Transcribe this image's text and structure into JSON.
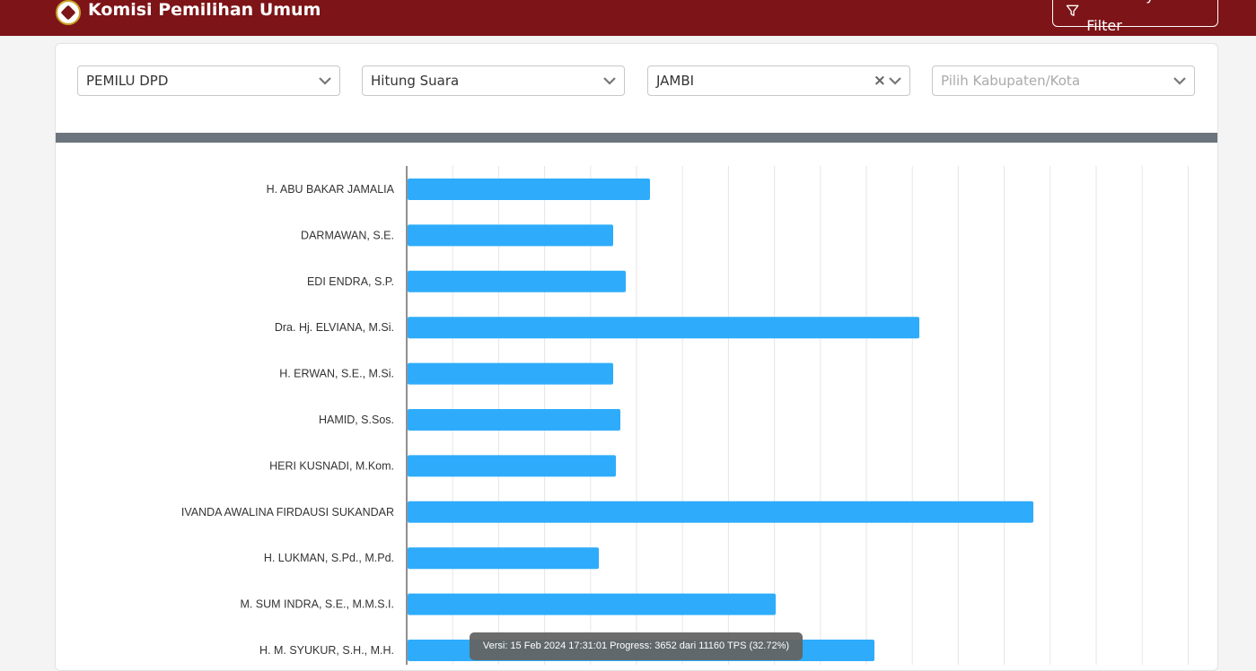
{
  "header": {
    "brand": "Komisi Pemilihan Umum",
    "filter_button": "Sembunyikan Filter"
  },
  "filters": {
    "election": "PEMILU DPD",
    "mode": "Hitung Suara",
    "province": "JAMBI",
    "regency_placeholder": "Pilih Kabupaten/Kota"
  },
  "colors": {
    "header_bg": "#7d1417",
    "bar": "#2eacfb",
    "divider": "#6c757d"
  },
  "tooltip": "Versi: 15 Feb 2024 17:31:01 Progress: 3652 dari 11160 TPS (32.72%)",
  "chart_data": {
    "type": "bar",
    "orientation": "horizontal",
    "grid": true,
    "categories": [
      "H. ABU BAKAR JAMALIA",
      "DARMAWAN, S.E.",
      "EDI ENDRA, S.P.",
      "Dra. Hj. ELVIANA, M.Si.",
      "H. ERWAN, S.E., M.Si.",
      "HAMID, S.Sos.",
      "HERI KUSNADI, M.Kom.",
      "IVANDA AWALINA FIRDAUSI SUKANDAR",
      "H. LUKMAN, S.Pd., M.Pd.",
      "M. SUM INDRA, S.E., M.M.S.I.",
      "H. M. SYUKUR, S.H., M.H."
    ],
    "values": [
      270,
      229,
      243,
      570,
      229,
      237,
      232,
      697,
      213,
      410,
      520
    ],
    "xlim": [
      0,
      880
    ]
  }
}
